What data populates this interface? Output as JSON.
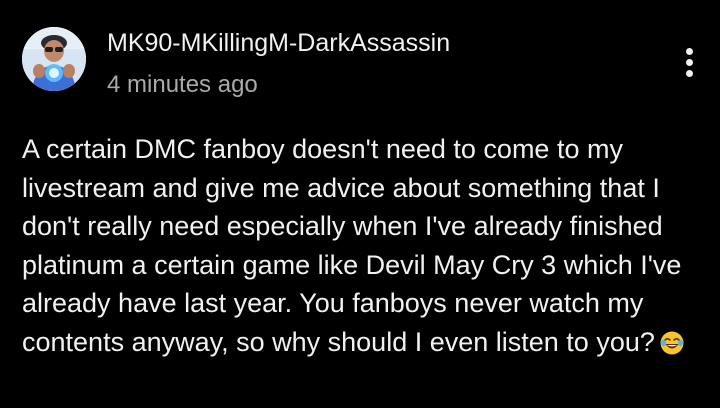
{
  "comment": {
    "author": "MK90-MKillingM-DarkAssassin",
    "timestamp": "4 minutes ago",
    "text": "A certain DMC fanboy doesn't need to come to my livestream and give me advice about something that I don't really need especially when I've already finished platinum a certain game like Devil May Cry 3 which I've already have last year. You fanboys never watch my contents anyway, so why should I even listen to you?",
    "emoji": "tears-of-joy-emoji"
  },
  "icons": {
    "avatar": "avatar-image",
    "menu": "more-vertical-icon"
  },
  "colors": {
    "background": "#000000",
    "primary_text": "#f1f1f1",
    "secondary_text": "#aaaaaa"
  }
}
